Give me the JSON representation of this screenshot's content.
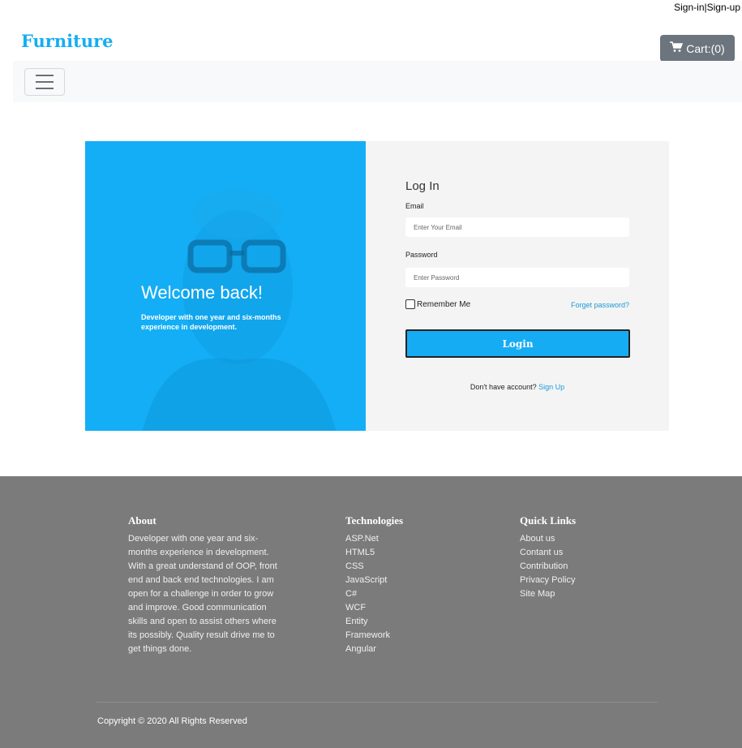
{
  "header": {
    "auth_links": {
      "signin": "Sign-in",
      "sep": "|",
      "signup": "Sign-up"
    },
    "brand": "Furniture",
    "cart_label": "Cart:(0)",
    "cart_icon": "cart-icon",
    "menu_icon": "hamburger-icon"
  },
  "welcome": {
    "title": "Welcome back!",
    "subtitle": "Developer with one year and six-months experience in development."
  },
  "login": {
    "title": "Log In",
    "email_label": "Email",
    "email_placeholder": "Enter Your Email",
    "password_label": "Password",
    "password_placeholder": "Enter Password",
    "remember_label": "Remember Me",
    "forgot_label": "Forget password?",
    "button_label": "Login",
    "no_account": "Don't have account?",
    "signup_link": "Sign Up"
  },
  "footer": {
    "about": {
      "title": "About",
      "text": "Developer with one year and six-months experience in development. With a great understand of OOP, front end and back end technologies. I am open for a challenge in order to grow and improve. Good communication skills and open to assist others where its possibly. Quality result drive me to get things done."
    },
    "technologies": {
      "title": "Technologies",
      "items": [
        "ASP.Net",
        "HTML5",
        "CSS",
        "JavaScript",
        "C#",
        "WCF",
        "Entity",
        "Framework",
        "Angular"
      ]
    },
    "quick_links": {
      "title": "Quick Links",
      "items": [
        "About us",
        "Contant us",
        "Contribution",
        "Privacy Policy",
        "Site Map"
      ]
    },
    "copyright": "Copyright © 2020 All Rights Reserved"
  },
  "colors": {
    "brand": "#15aef0",
    "welcome_panel": "#14aef6",
    "login_button": "#16acf4",
    "footer_bg": "#7b7b7b",
    "cart_bg": "#6c757d"
  }
}
